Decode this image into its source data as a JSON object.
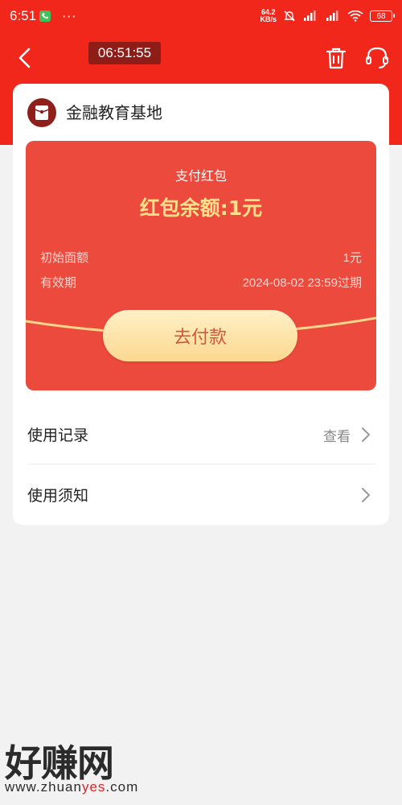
{
  "status_bar": {
    "time": "6:51",
    "dots": "···",
    "net_speed_value": "64.2",
    "net_speed_unit": "KB/s",
    "battery": "68"
  },
  "nav": {
    "clock": "06:51:55"
  },
  "merchant": {
    "name": "金融教育基地"
  },
  "coupon": {
    "title": "支付红包",
    "balance": "红包余额:1元",
    "rows": [
      {
        "label": "初始面额",
        "value": "1元"
      },
      {
        "label": "有效期",
        "value": "2024-08-02 23:59过期"
      }
    ],
    "pay_label": "去付款"
  },
  "list": {
    "records_label": "使用记录",
    "records_action": "查看",
    "notice_label": "使用须知"
  },
  "watermark": {
    "logo": "好赚网",
    "url_prefix": "www.zhuan",
    "url_highlight": "yes",
    "url_suffix": ".com"
  },
  "colors": {
    "header_red": "#f2271c",
    "coupon_red": "#ed4a3e",
    "balance_gold": "#ffe08a",
    "watermark_highlight": "#e02020"
  }
}
